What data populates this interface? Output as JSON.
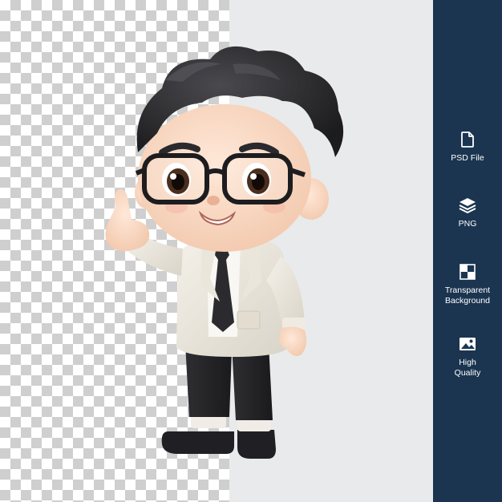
{
  "colors": {
    "sidebar_bg": "#1b3550",
    "panel_bg": "#e9eaec",
    "checker_dark": "#cfcfcf",
    "checker_light": "#ffffff"
  },
  "preview": {
    "subject": "character-3d-businessman-pointing-icon"
  },
  "sidebar": {
    "features": [
      {
        "icon": "file-icon",
        "label": "PSD File"
      },
      {
        "icon": "layers-icon",
        "label": "PNG"
      },
      {
        "icon": "transparency-icon",
        "label": "Transparent\nBackground"
      },
      {
        "icon": "image-icon",
        "label": "High\nQuality"
      }
    ]
  }
}
